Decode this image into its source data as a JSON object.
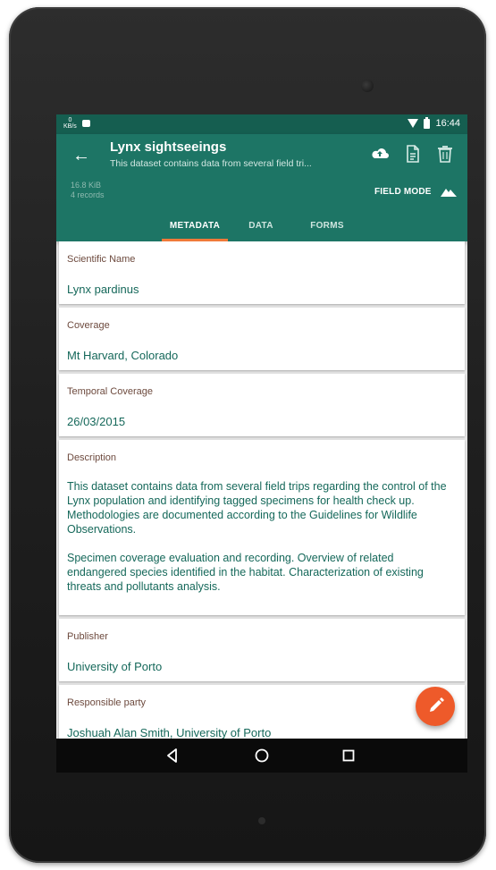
{
  "status_bar": {
    "network_speed_value": "0",
    "network_speed_unit": "KB/s",
    "time": "16:44"
  },
  "app_bar": {
    "title": "Lynx sightseeings",
    "subtitle": "This dataset contains data from several field tri...",
    "size": "16.8 KiB",
    "records": "4 records",
    "field_mode_label": "FIELD MODE",
    "actions": [
      "upload-cloud-icon",
      "export-file-icon",
      "delete-icon"
    ]
  },
  "tabs": [
    {
      "label": "METADATA",
      "active": true
    },
    {
      "label": "DATA",
      "active": false
    },
    {
      "label": "FORMS",
      "active": false
    }
  ],
  "fields": {
    "scientific_name": {
      "label": "Scientific Name",
      "value": "Lynx pardinus"
    },
    "coverage": {
      "label": "Coverage",
      "value": "Mt Harvard, Colorado"
    },
    "temporal_coverage": {
      "label": "Temporal Coverage",
      "value": "26/03/2015"
    },
    "description": {
      "label": "Description",
      "paragraphs": [
        "This dataset contains data from several field trips regarding the control of the Lynx population and identifying tagged specimens for health check up. Methodologies are documented according to the Guidelines for Wildlife Observations.",
        "Specimen coverage evaluation and recording. Overview of related endangered species identified in the habitat. Characterization of existing threats and pollutants analysis."
      ]
    },
    "publisher": {
      "label": "Publisher",
      "value": "University of Porto"
    },
    "responsible_party": {
      "label": "Responsible party",
      "value": "Joshuah Alan Smith, University of Porto"
    }
  },
  "fab": {
    "icon": "edit-pencil-icon"
  },
  "nav_bar": {
    "buttons": [
      "back-triangle-icon",
      "home-circle-icon",
      "recents-square-icon"
    ]
  },
  "colors": {
    "primary": "#1d7565",
    "primary_dark": "#155e50",
    "accent": "#ee5a2a",
    "tab_indicator": "#f07a3a",
    "label_text": "#6d4a3e",
    "value_text": "#15685a"
  }
}
